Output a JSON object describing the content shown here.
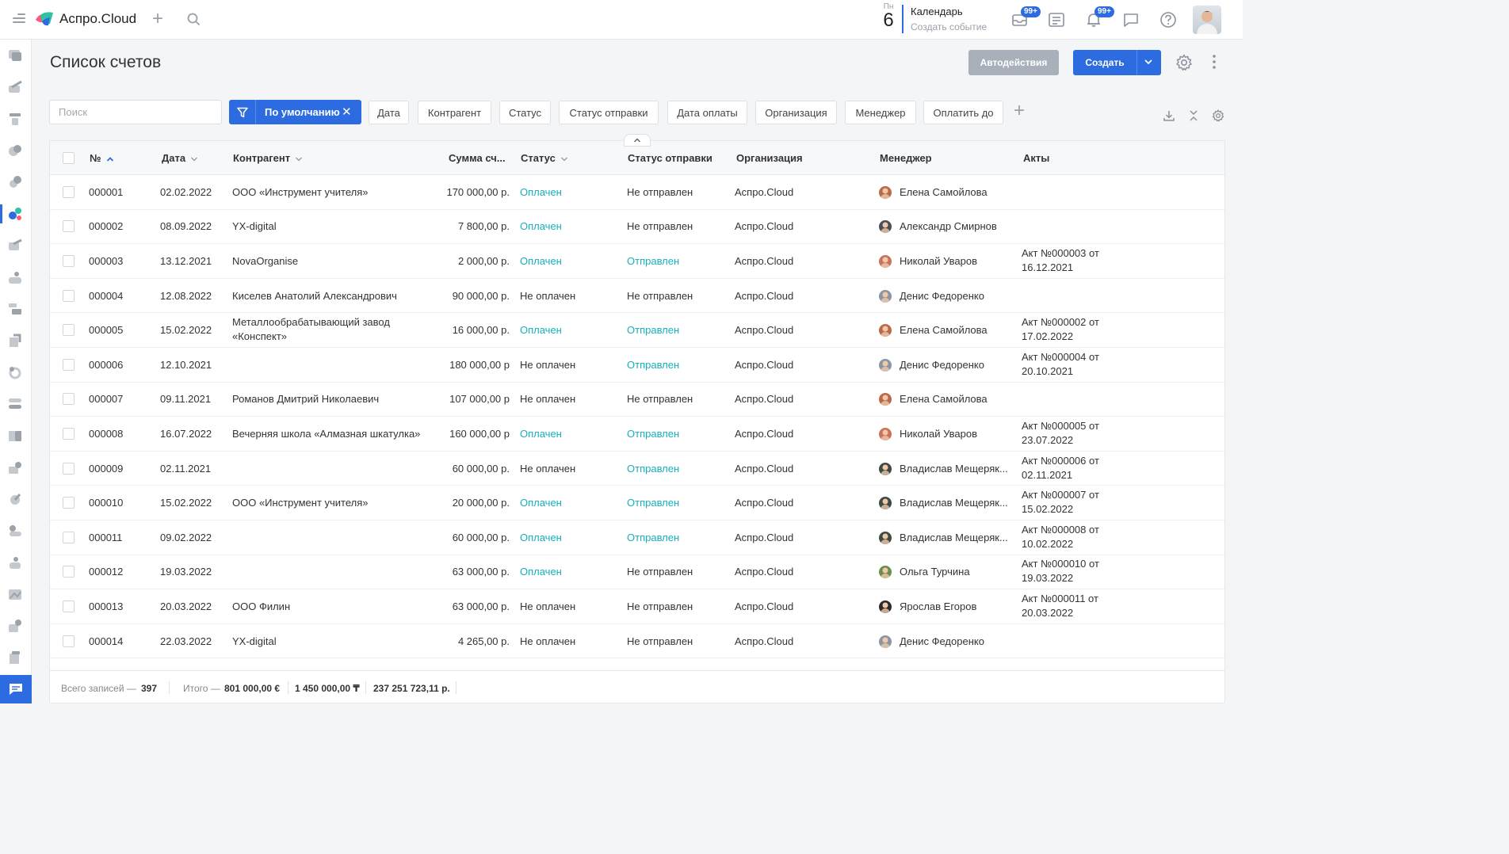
{
  "topbar": {
    "brand": "Аспро.Cloud",
    "calendar": {
      "weekday": "Пн",
      "day": "6",
      "title": "Календарь",
      "subtitle": "Создать событие"
    },
    "badges": {
      "mail": "99+",
      "notifications": "99+"
    }
  },
  "header": {
    "title": "Список счетов",
    "auto_actions_label": "Автодействия",
    "create_label": "Создать"
  },
  "filters": {
    "search_placeholder": "Поиск",
    "active_filter": "По умолчанию",
    "buttons": [
      "Дата",
      "Контрагент",
      "Статус",
      "Статус отправки",
      "Дата оплаты",
      "Организация",
      "Менеджер",
      "Оплатить до"
    ]
  },
  "table": {
    "columns": {
      "num": "№",
      "date": "Дата",
      "counterparty": "Контрагент",
      "amount": "Сумма сч...",
      "status": "Статус",
      "send_status": "Статус отправки",
      "organization": "Организация",
      "manager": "Менеджер",
      "acts": "Акты"
    },
    "rows": [
      {
        "num": "000001",
        "date": "02.02.2022",
        "counterparty": [
          "ООО «Инструмент учителя»"
        ],
        "amount": "170 000,00 р.",
        "status": "Оплачен",
        "status_paid": true,
        "send_status": "Не отправлен",
        "sent": false,
        "org": "Аспро.Cloud",
        "manager": "Елена Самойлова",
        "avatar_color": "#b86b4b",
        "acts": []
      },
      {
        "num": "000002",
        "date": "08.09.2022",
        "counterparty": [
          "YX-digital"
        ],
        "amount": "7 800,00 р.",
        "status": "Оплачен",
        "status_paid": true,
        "send_status": "Не отправлен",
        "sent": false,
        "org": "Аспро.Cloud",
        "manager": "Александр Смирнов",
        "avatar_color": "#4a4f57",
        "acts": []
      },
      {
        "num": "000003",
        "date": "13.12.2021",
        "counterparty": [
          "NovaOrganise"
        ],
        "amount": "2 000,00 р.",
        "status": "Оплачен",
        "status_paid": true,
        "send_status": "Отправлен",
        "sent": true,
        "org": "Аспро.Cloud",
        "manager": "Николай Уваров",
        "avatar_color": "#c9725e",
        "acts": [
          "Акт №000003 от",
          "16.12.2021"
        ]
      },
      {
        "num": "000004",
        "date": "12.08.2022",
        "counterparty": [
          "Киселев Анатолий Александрович"
        ],
        "amount": "90 000,00 р.",
        "status": "Не оплачен",
        "status_paid": false,
        "send_status": "Не отправлен",
        "sent": false,
        "org": "Аспро.Cloud",
        "manager": "Денис Федоренко",
        "avatar_color": "#8c96a3",
        "acts": []
      },
      {
        "num": "000005",
        "date": "15.02.2022",
        "counterparty": [
          "Металлообрабатывающий завод",
          "«Конспект»"
        ],
        "amount": "16 000,00 р.",
        "status": "Оплачен",
        "status_paid": true,
        "send_status": "Отправлен",
        "sent": true,
        "org": "Аспро.Cloud",
        "manager": "Елена Самойлова",
        "avatar_color": "#b86b4b",
        "acts": [
          "Акт №000002 от",
          "17.02.2022"
        ]
      },
      {
        "num": "000006",
        "date": "12.10.2021",
        "counterparty": [],
        "amount": "180 000,00 р",
        "status": "Не оплачен",
        "status_paid": false,
        "send_status": "Отправлен",
        "sent": true,
        "org": "Аспро.Cloud",
        "manager": "Денис Федоренко",
        "avatar_color": "#8c96a3",
        "acts": [
          "Акт №000004 от",
          "20.10.2021"
        ]
      },
      {
        "num": "000007",
        "date": "09.11.2021",
        "counterparty": [
          "Романов Дмитрий Николаевич"
        ],
        "amount": "107 000,00 р",
        "status": "Не оплачен",
        "status_paid": false,
        "send_status": "Не отправлен",
        "sent": false,
        "org": "Аспро.Cloud",
        "manager": "Елена Самойлова",
        "avatar_color": "#b86b4b",
        "acts": []
      },
      {
        "num": "000008",
        "date": "16.07.2022",
        "counterparty": [
          "Вечерняя школа «Алмазная шкатулка»"
        ],
        "amount": "160 000,00 р",
        "status": "Оплачен",
        "status_paid": true,
        "send_status": "Отправлен",
        "sent": true,
        "org": "Аспро.Cloud",
        "manager": "Николай Уваров",
        "avatar_color": "#c9725e",
        "acts": [
          "Акт №000005 от",
          "23.07.2022"
        ]
      },
      {
        "num": "000009",
        "date": "02.11.2021",
        "counterparty": [],
        "amount": "60 000,00 р.",
        "status": "Не оплачен",
        "status_paid": false,
        "send_status": "Отправлен",
        "sent": true,
        "org": "Аспро.Cloud",
        "manager": "Владислав Мещеряк...",
        "avatar_color": "#3e4a44",
        "acts": [
          "Акт №000006 от",
          "02.11.2021"
        ]
      },
      {
        "num": "000010",
        "date": "15.02.2022",
        "counterparty": [
          "ООО «Инструмент учителя»"
        ],
        "amount": "20 000,00 р.",
        "status": "Оплачен",
        "status_paid": true,
        "send_status": "Отправлен",
        "sent": true,
        "org": "Аспро.Cloud",
        "manager": "Владислав Мещеряк...",
        "avatar_color": "#3e4a44",
        "acts": [
          "Акт №000007 от",
          "15.02.2022"
        ]
      },
      {
        "num": "000011",
        "date": "09.02.2022",
        "counterparty": [],
        "amount": "60 000,00 р.",
        "status": "Оплачен",
        "status_paid": true,
        "send_status": "Отправлен",
        "sent": true,
        "org": "Аспро.Cloud",
        "manager": "Владислав Мещеряк...",
        "avatar_color": "#3e4a44",
        "acts": [
          "Акт №000008 от",
          "10.02.2022"
        ]
      },
      {
        "num": "000012",
        "date": "19.03.2022",
        "counterparty": [],
        "amount": "63 000,00 р.",
        "status": "Оплачен",
        "status_paid": true,
        "send_status": "Не отправлен",
        "sent": false,
        "org": "Аспро.Cloud",
        "manager": "Ольга Турчина",
        "avatar_color": "#6b8e4e",
        "acts": [
          "Акт №000010 от",
          "19.03.2022"
        ]
      },
      {
        "num": "000013",
        "date": "20.03.2022",
        "counterparty": [
          "ООО Филин"
        ],
        "amount": "63 000,00 р.",
        "status": "Не оплачен",
        "status_paid": false,
        "send_status": "Не отправлен",
        "sent": false,
        "org": "Аспро.Cloud",
        "manager": "Ярослав Егоров",
        "avatar_color": "#2e2a2a",
        "acts": [
          "Акт №000011 от",
          "20.03.2022"
        ]
      },
      {
        "num": "000014",
        "date": "22.03.2022",
        "counterparty": [
          "YX-digital"
        ],
        "amount": "4 265,00 р.",
        "status": "Не оплачен",
        "status_paid": false,
        "send_status": "Не отправлен",
        "sent": false,
        "org": "Аспро.Cloud",
        "manager": "Денис Федоренко",
        "avatar_color": "#8c96a3",
        "acts": []
      }
    ]
  },
  "footer": {
    "total_label": "Всего записей —",
    "total_value": "397",
    "sum_label": "Итого —",
    "sum_eur": "801 000,00 €",
    "sum_kzt": "1 450 000,00 ₸",
    "sum_rub": "237 251 723,11 р."
  },
  "colors": {
    "accent": "#2c6be0",
    "paid": "#16b0ba",
    "muted_button": "#a9b0b9"
  }
}
